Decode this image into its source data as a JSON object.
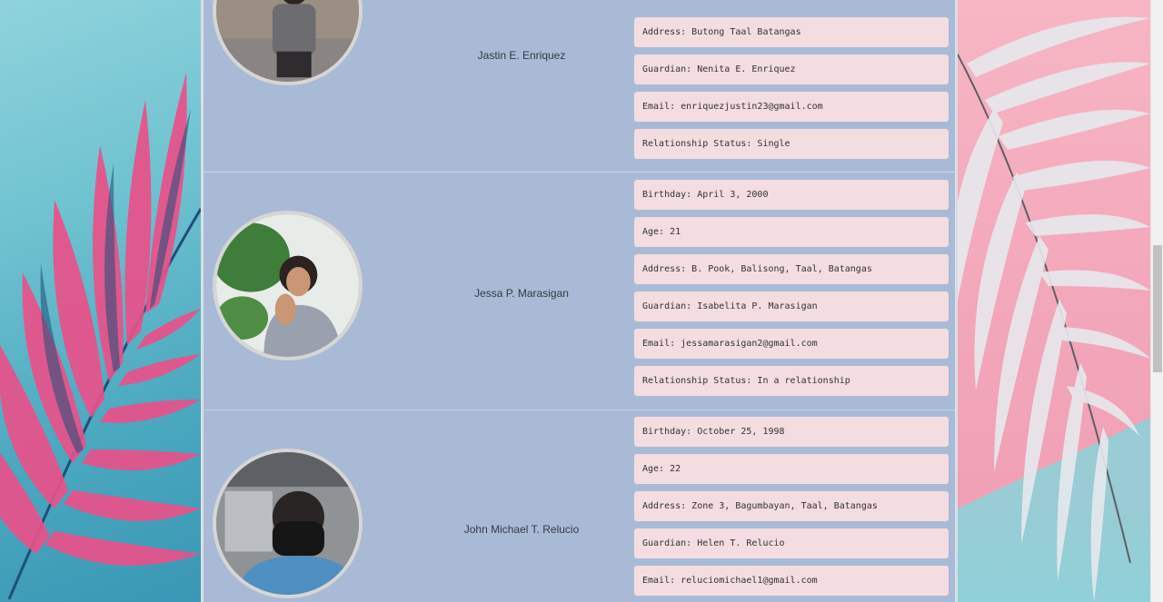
{
  "profiles": [
    {
      "name": "Jastin E. Enriquez",
      "fields": [
        "",
        "Address: Butong Taal Batangas",
        "Guardian: Nenita E. Enriquez",
        "Email: enriquezjustin23@gmail.com",
        "Relationship Status: Single"
      ]
    },
    {
      "name": "Jessa P. Marasigan",
      "fields": [
        "Birthday: April 3, 2000",
        "Age: 21",
        "Address: B. Pook, Balisong, Taal, Batangas",
        "Guardian: Isabelita P. Marasigan",
        "Email: jessamarasigan2@gmail.com",
        "Relationship Status: In a relationship"
      ]
    },
    {
      "name": "John Michael T. Relucio",
      "fields": [
        "Birthday: October 25, 1998",
        "Age: 22",
        "Address: Zone 3, Bagumbayan, Taal, Batangas",
        "Guardian: Helen T. Relucio",
        "Email: reluciomichael1@gmail.com"
      ]
    }
  ],
  "colors": {
    "panel": "#a9bad6",
    "field": "#f3dde0",
    "left_bg": "#6fc2d0",
    "right_bg": "#f3a7ba"
  }
}
